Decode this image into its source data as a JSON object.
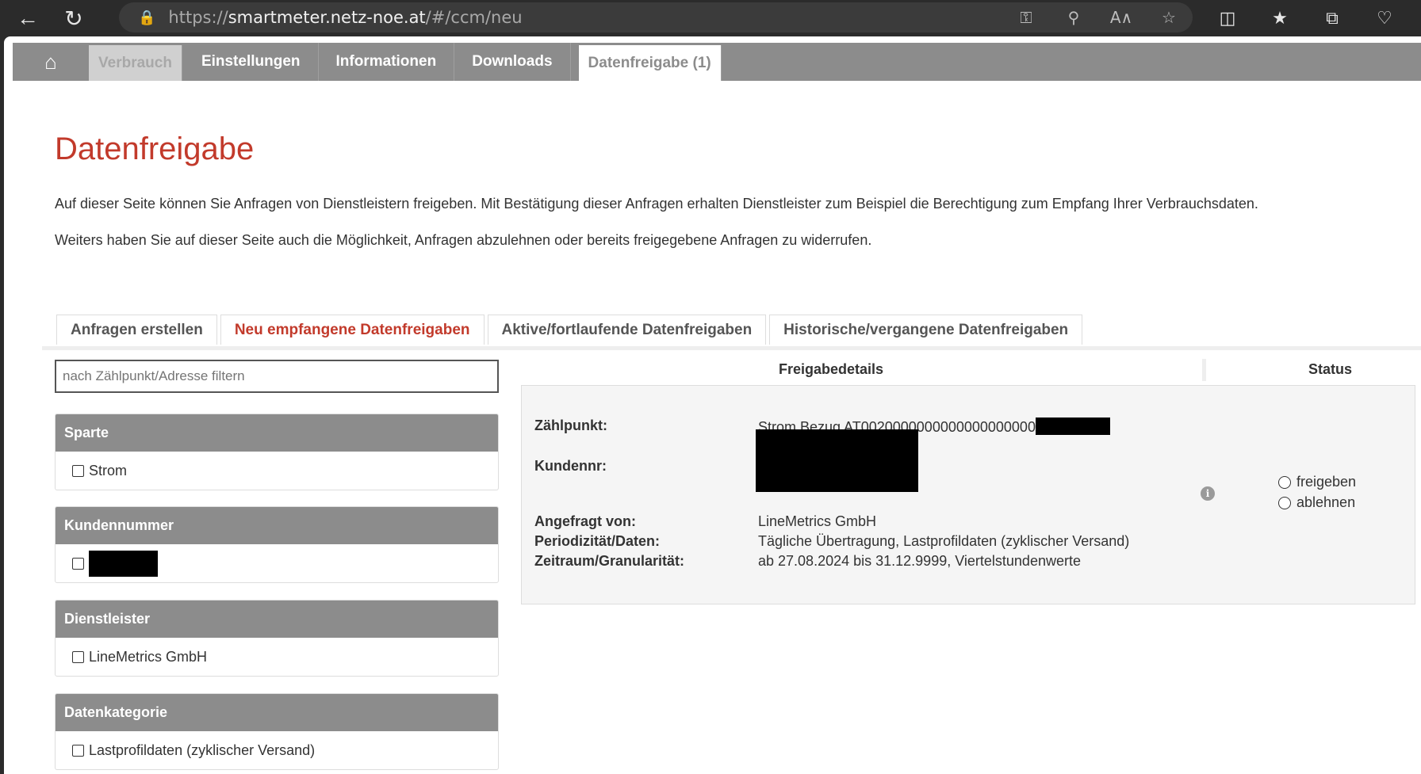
{
  "browser": {
    "url_protocol": "https://",
    "url_host": "smartmeter.netz-noe.at",
    "url_path": "/#/ccm/neu"
  },
  "nav": {
    "items": [
      "Verbrauch",
      "Einstellungen",
      "Informationen",
      "Downloads"
    ],
    "active": "Datenfreigabe (1)"
  },
  "page": {
    "title": "Datenfreigabe",
    "intro1": "Auf dieser Seite können Sie Anfragen von Dienstleistern freigeben. Mit Bestätigung dieser Anfragen erhalten Dienstleister zum Beispiel die Berechtigung zum Empfang Ihrer Verbrauchsdaten.",
    "intro2": "Weiters haben Sie auf dieser Seite auch die Möglichkeit, Anfragen abzulehnen oder bereits freigegebene Anfragen zu widerrufen."
  },
  "tabs": [
    "Anfragen erstellen",
    "Neu empfangene Datenfreigaben",
    "Aktive/fortlaufende Datenfreigaben",
    "Historische/vergangene Datenfreigaben"
  ],
  "filter": {
    "placeholder": "nach Zählpunkt/Adresse filtern"
  },
  "facets": {
    "sparte": {
      "title": "Sparte",
      "option": "Strom"
    },
    "kundennummer": {
      "title": "Kundennummer"
    },
    "dienstleister": {
      "title": "Dienstleister",
      "option": "LineMetrics GmbH"
    },
    "datenkategorie": {
      "title": "Datenkategorie",
      "option": "Lastprofildaten (zyklischer Versand)"
    }
  },
  "columns": {
    "details": "Freigabedetails",
    "status": "Status"
  },
  "request": {
    "zaehlpunkt_label": "Zählpunkt:",
    "zaehlpunkt_value": "Strom Bezug AT0020000000000000000000",
    "kundennr_label": "Kundennr:",
    "angefragt_label": "Angefragt von:",
    "angefragt_value": "LineMetrics GmbH",
    "periodizitaet_label": "Periodizität/Daten:",
    "periodizitaet_value": "Tägliche Übertragung, Lastprofildaten (zyklischer Versand)",
    "zeitraum_label": "Zeitraum/Granularität:",
    "zeitraum_value": "ab 27.08.2024 bis 31.12.9999, Viertelstundenwerte",
    "approve_label": "freigeben",
    "reject_label": "ablehnen"
  },
  "icons": [
    "back-icon",
    "refresh-icon",
    "lock-icon",
    "key-icon",
    "zoom-out-icon",
    "read-aloud-icon",
    "favorite-icon",
    "split-screen-icon",
    "favorites-icon",
    "collections-icon",
    "health-icon",
    "home-icon",
    "info-icon"
  ]
}
